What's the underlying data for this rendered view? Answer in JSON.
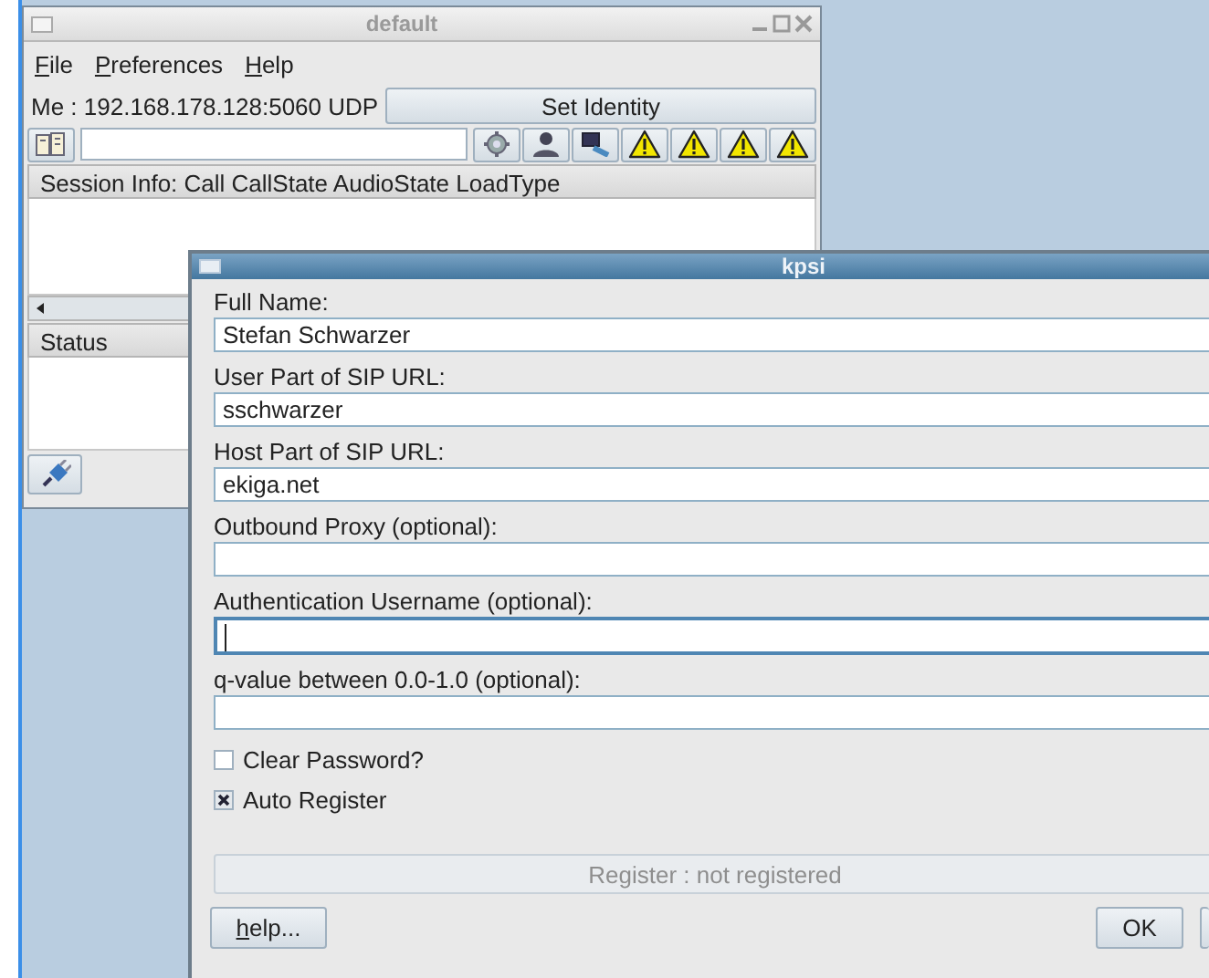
{
  "main_window": {
    "title": "default",
    "menu": [
      "File",
      "Preferences",
      "Help"
    ],
    "identity_label": "Me : 192.168.178.128:5060 UDP",
    "identity_button": "Set Identity",
    "sessions_header": "Session Info: Call CallState AudioState LoadType",
    "status_header": "Status"
  },
  "dialog": {
    "title": "kpsi",
    "fields": [
      {
        "label": "Full Name:",
        "value": "Stefan Schwarzer",
        "focused": false
      },
      {
        "label": "User Part of SIP URL:",
        "value": "sschwarzer",
        "focused": false
      },
      {
        "label": "Host Part of SIP URL:",
        "value": "ekiga.net",
        "focused": false
      },
      {
        "label": "Outbound Proxy (optional):",
        "focused": false
      },
      {
        "label": "Authentication Username (optional):",
        "focused": true
      },
      {
        "label": "q-value between 0.0-1.0 (optional):",
        "focused": false
      }
    ],
    "checkboxes": [
      {
        "label": "Clear Password?",
        "checked": false
      },
      {
        "label": "Auto Register",
        "checked": true
      }
    ],
    "register_button": {
      "label": "Register : not registered",
      "disabled": true
    },
    "buttons": [
      {
        "label": "help...",
        "kind": "help"
      },
      {
        "label": "OK",
        "kind": "ok"
      }
    ]
  }
}
